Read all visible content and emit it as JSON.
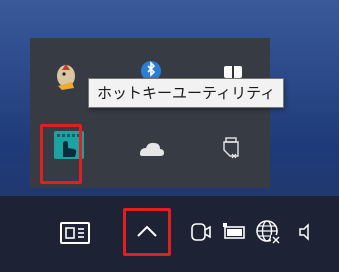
{
  "tooltip": {
    "text": "ホットキーユーティリティ"
  },
  "tray_flyout": {
    "icons": [
      "dragon-app-icon",
      "bluetooth-icon",
      "usb-drive-icon",
      "hotkey-utility-icon",
      "onedrive-cloud-icon",
      "safely-remove-device-icon"
    ]
  },
  "taskbar": {
    "icons": [
      "news-widget-icon",
      "show-hidden-icons-chevron-icon",
      "camera-icon",
      "battery-icon",
      "network-globe-icon",
      "speaker-icon"
    ]
  },
  "colors": {
    "highlight": "#e02020",
    "tooltip_bg": "#f2f2f2",
    "flyout_bg": "#373b44",
    "taskbar_bg": "#1d2334"
  }
}
